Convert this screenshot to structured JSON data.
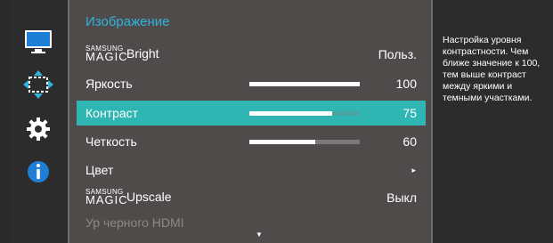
{
  "menu": {
    "title": "Изображение",
    "items": [
      {
        "label": "Bright",
        "brand": "SAMSUNG",
        "magic": "MAGIC",
        "value": "Польз."
      },
      {
        "label": "Яркость",
        "value": "100",
        "level": 1.0
      },
      {
        "label": "Контраст",
        "value": "75",
        "level": 0.75,
        "selected": true
      },
      {
        "label": "Четкость",
        "value": "60",
        "level": 0.6
      },
      {
        "label": "Цвет",
        "arrow": "▸"
      },
      {
        "label": "Upscale",
        "brand": "SAMSUNG",
        "magic": "MAGIC",
        "value": "Выкл"
      },
      {
        "label": "Ур черного HDMI",
        "disabled": true
      }
    ],
    "scroll_indicator": "▼"
  },
  "sidebar": {
    "icons": [
      "monitor-icon",
      "resize-arrows-icon",
      "gear-icon",
      "info-icon"
    ]
  },
  "help": {
    "text": "Настройка уровня контрастности. Чем ближе значение к 100, тем выше контраст между яркими и темными участками."
  },
  "colors": {
    "accent": "#2fb3dd",
    "selected": "#2fb6b2",
    "menu_bg": "#4f4b4b"
  }
}
